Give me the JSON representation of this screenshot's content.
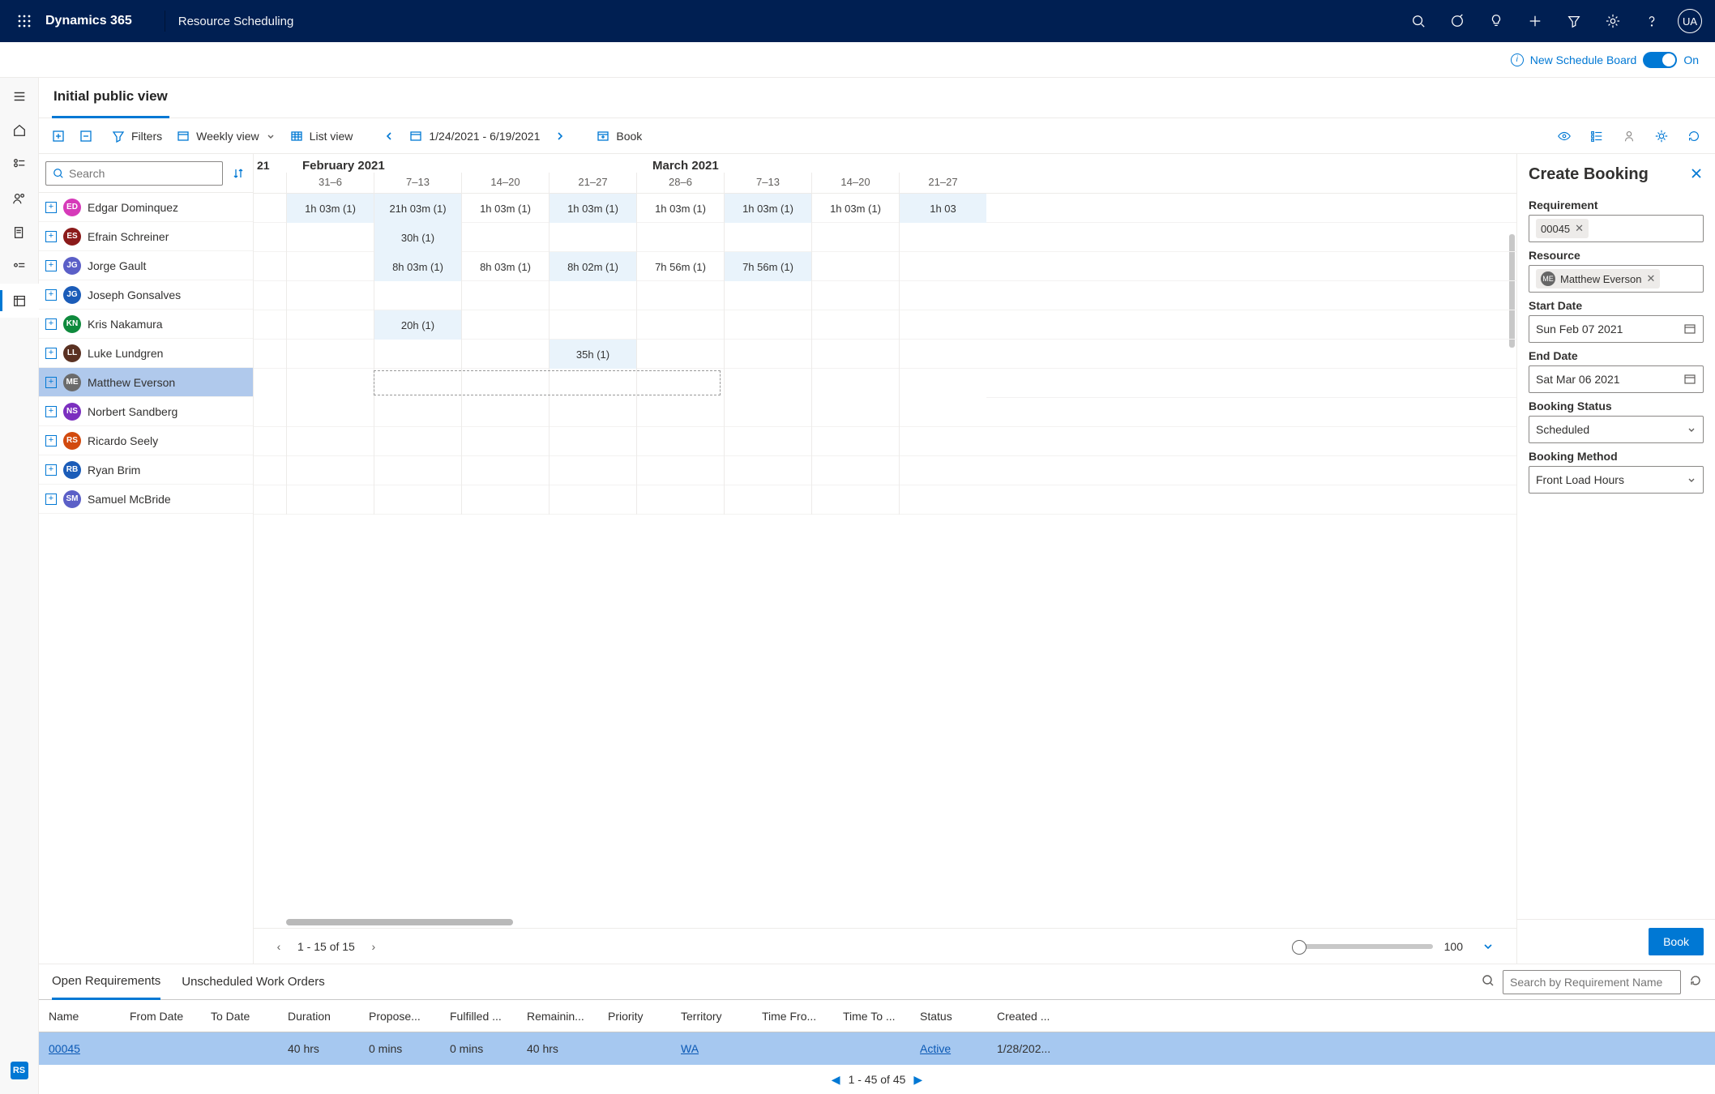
{
  "header": {
    "brand": "Dynamics 365",
    "appName": "Resource Scheduling",
    "avatar": "UA"
  },
  "subheader": {
    "label": "New Schedule Board",
    "state": "On"
  },
  "tab": "Initial public view",
  "toolbar": {
    "filters": "Filters",
    "view": "Weekly view",
    "list": "List view",
    "range": "1/24/2021 - 6/19/2021",
    "book": "Book"
  },
  "searchPlaceholder": "Search",
  "resources": [
    {
      "initials": "ED",
      "name": "Edgar Dominquez",
      "color": "#d63ab9"
    },
    {
      "initials": "ES",
      "name": "Efrain Schreiner",
      "color": "#8b1a1a"
    },
    {
      "initials": "JG",
      "name": "Jorge Gault",
      "color": "#5b5fc7"
    },
    {
      "initials": "JG",
      "name": "Joseph Gonsalves",
      "color": "#1b5cb8"
    },
    {
      "initials": "KN",
      "name": "Kris Nakamura",
      "color": "#0f8a3d"
    },
    {
      "initials": "LL",
      "name": "Luke Lundgren",
      "color": "#5a3122"
    },
    {
      "initials": "ME",
      "name": "Matthew Everson",
      "color": "#6b6b6b",
      "selected": true
    },
    {
      "initials": "NS",
      "name": "Norbert Sandberg",
      "color": "#7b2fbf"
    },
    {
      "initials": "RS",
      "name": "Ricardo Seely",
      "color": "#d24a0e"
    },
    {
      "initials": "RB",
      "name": "Ryan Brim",
      "color": "#1b5cb8"
    },
    {
      "initials": "SM",
      "name": "Samuel McBride",
      "color": "#5b5fc7"
    }
  ],
  "grid": {
    "leading": "21",
    "months": [
      "February 2021",
      "March 2021"
    ],
    "monthSpans": [
      4,
      4
    ],
    "weeks": [
      "31–6",
      "7–13",
      "14–20",
      "21–27",
      "28–6",
      "7–13",
      "14–20",
      "21–27"
    ],
    "rows": [
      [
        [
          "1h 03m (1)",
          true
        ],
        [
          "21h 03m (1)",
          true
        ],
        [
          "1h 03m (1)",
          false
        ],
        [
          "1h 03m (1)",
          true
        ],
        [
          "1h 03m (1)",
          false
        ],
        [
          "1h 03m (1)",
          true
        ],
        [
          "1h 03m (1)",
          false
        ],
        [
          "1h 03",
          true
        ]
      ],
      [
        [
          "",
          false
        ],
        [
          "30h (1)",
          true
        ],
        [
          "",
          false
        ],
        [
          "",
          false
        ],
        [
          "",
          false
        ],
        [
          "",
          false
        ],
        [
          "",
          false
        ],
        [
          "",
          false
        ]
      ],
      [
        [
          "",
          false
        ],
        [
          "8h 03m (1)",
          true
        ],
        [
          "8h 03m (1)",
          false
        ],
        [
          "8h 02m (1)",
          true
        ],
        [
          "7h 56m (1)",
          false
        ],
        [
          "7h 56m (1)",
          true
        ],
        [
          "",
          false
        ],
        [
          "",
          false
        ]
      ],
      [
        [
          "",
          false
        ],
        [
          "",
          false
        ],
        [
          "",
          false
        ],
        [
          "",
          false
        ],
        [
          "",
          false
        ],
        [
          "",
          false
        ],
        [
          "",
          false
        ],
        [
          "",
          false
        ]
      ],
      [
        [
          "",
          false
        ],
        [
          "20h (1)",
          true
        ],
        [
          "",
          false
        ],
        [
          "",
          false
        ],
        [
          "",
          false
        ],
        [
          "",
          false
        ],
        [
          "",
          false
        ],
        [
          "",
          false
        ]
      ],
      [
        [
          "",
          false
        ],
        [
          "",
          false
        ],
        [
          "",
          false
        ],
        [
          "35h (1)",
          true
        ],
        [
          "",
          false
        ],
        [
          "",
          false
        ],
        [
          "",
          false
        ],
        [
          "",
          false
        ]
      ],
      [
        [
          "",
          false
        ],
        [
          "",
          false
        ],
        [
          "",
          false
        ],
        [
          "",
          false
        ],
        [
          "",
          false
        ],
        [
          "",
          false
        ],
        [
          "",
          false
        ],
        [
          "",
          false
        ]
      ],
      [
        [
          "",
          false
        ],
        [
          "",
          false
        ],
        [
          "",
          false
        ],
        [
          "",
          false
        ],
        [
          "",
          false
        ],
        [
          "",
          false
        ],
        [
          "",
          false
        ],
        [
          "",
          false
        ]
      ],
      [
        [
          "",
          false
        ],
        [
          "",
          false
        ],
        [
          "",
          false
        ],
        [
          "",
          false
        ],
        [
          "",
          false
        ],
        [
          "",
          false
        ],
        [
          "",
          false
        ],
        [
          "",
          false
        ]
      ],
      [
        [
          "",
          false
        ],
        [
          "",
          false
        ],
        [
          "",
          false
        ],
        [
          "",
          false
        ],
        [
          "",
          false
        ],
        [
          "",
          false
        ],
        [
          "",
          false
        ],
        [
          "",
          false
        ]
      ],
      [
        [
          "",
          false
        ],
        [
          "",
          false
        ],
        [
          "",
          false
        ],
        [
          "",
          false
        ],
        [
          "",
          false
        ],
        [
          "",
          false
        ],
        [
          "",
          false
        ],
        [
          "",
          false
        ]
      ]
    ]
  },
  "pager": {
    "text": "1 - 15 of 15",
    "sliderValue": "100"
  },
  "sidePanel": {
    "title": "Create Booking",
    "fields": {
      "requirementLabel": "Requirement",
      "requirementValue": "00045",
      "resourceLabel": "Resource",
      "resourceValue": "Matthew Everson",
      "resourceInitials": "ME",
      "startLabel": "Start Date",
      "startValue": "Sun Feb 07 2021",
      "endLabel": "End Date",
      "endValue": "Sat Mar 06 2021",
      "statusLabel": "Booking Status",
      "statusValue": "Scheduled",
      "methodLabel": "Booking Method",
      "methodValue": "Front Load Hours"
    },
    "button": "Book"
  },
  "bottom": {
    "tabs": [
      "Open Requirements",
      "Unscheduled Work Orders"
    ],
    "searchPlaceholder": "Search by Requirement Name",
    "columns": [
      "Name",
      "From Date",
      "To Date",
      "Duration",
      "Propose...",
      "Fulfilled ...",
      "Remainin...",
      "Priority",
      "Territory",
      "Time Fro...",
      "Time To ...",
      "Status",
      "Created ..."
    ],
    "row": {
      "name": "00045",
      "duration": "40 hrs",
      "proposed": "0 mins",
      "fulfilled": "0 mins",
      "remaining": "40 hrs",
      "territory": "WA",
      "status": "Active",
      "created": "1/28/202..."
    },
    "pager": "1 - 45 of 45"
  }
}
